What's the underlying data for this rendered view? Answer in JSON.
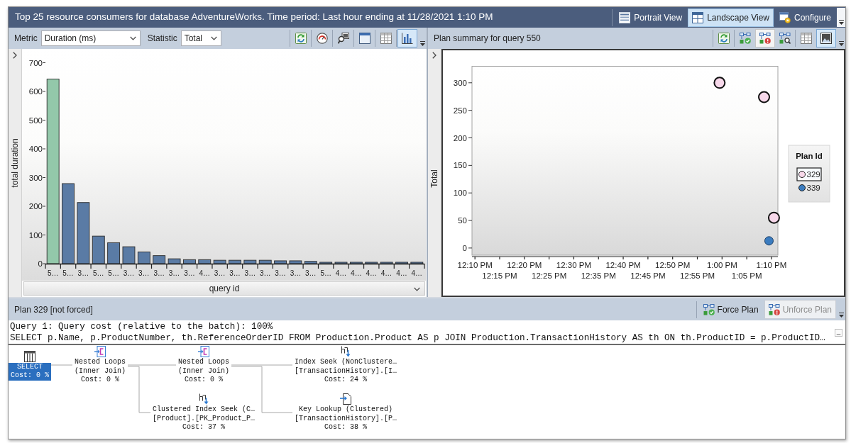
{
  "window": {
    "title": "Top 25 resource consumers for database AdventureWorks. Time period: Last hour ending at 11/28/2021 1:10 PM",
    "view_buttons": [
      {
        "kind": "portrait",
        "label": "Portrait View",
        "selected": false
      },
      {
        "kind": "landscape",
        "label": "Landscape View",
        "selected": true
      },
      {
        "kind": "configure",
        "label": "Configure",
        "selected": false
      }
    ]
  },
  "top_consumers": {
    "fields": [
      {
        "label": "Metric",
        "value": "Duration (ms)"
      },
      {
        "label": "Statistic",
        "value": "Total"
      }
    ],
    "toolbar": [
      {
        "kind": "refresh",
        "selected": false
      },
      {
        "kind": "track",
        "selected": false
      },
      {
        "kind": "view_query",
        "selected": false
      },
      {
        "kind": "window",
        "selected": false
      },
      {
        "kind": "grid",
        "selected": false
      },
      {
        "kind": "bar_chart",
        "selected": true
      }
    ],
    "chart_data": {
      "type": "bar",
      "xlabel": "query id",
      "ylabel": "total duration",
      "categories": [
        "5…",
        "5…",
        "3…",
        "5…",
        "5…",
        "3…",
        "3…",
        "3…",
        "3…",
        "3…",
        "4…",
        "3…",
        "3…",
        "3…",
        "3…",
        "3…",
        "3…",
        "3…",
        "5…",
        "4…",
        "4…",
        "4…",
        "4…",
        "4…",
        "4…"
      ],
      "series": [
        {
          "color": "#93c8aa",
          "values": [
            643,
            null,
            null,
            null,
            null,
            null,
            null,
            null,
            null,
            null,
            null,
            null,
            null,
            null,
            null,
            null,
            null,
            null,
            null,
            null,
            null,
            null,
            null,
            null,
            null
          ]
        },
        {
          "color": "#5a7ba5",
          "values": [
            null,
            279,
            213,
            96,
            73,
            59,
            41,
            28,
            17,
            14,
            14,
            12,
            12,
            12,
            12,
            10,
            10,
            8,
            5,
            5,
            5,
            5,
            5,
            5,
            5
          ]
        }
      ],
      "stacked": true,
      "ylim": [
        0,
        700
      ],
      "yticks": [
        0,
        100,
        200,
        300,
        400,
        500,
        600,
        700
      ]
    }
  },
  "plan_summary": {
    "title": "Plan summary for query 550",
    "toolbar": [
      {
        "kind": "refresh",
        "selected": false,
        "disabled": false
      },
      {
        "kind": "force",
        "selected": false,
        "disabled": false
      },
      {
        "kind": "unforce",
        "selected": false,
        "disabled": true
      },
      {
        "kind": "compare",
        "selected": false,
        "disabled": false
      },
      {
        "kind": "grid",
        "selected": false,
        "disabled": false
      },
      {
        "kind": "chart_image",
        "selected": true,
        "disabled": false
      }
    ],
    "legend": {
      "title": "Plan Id",
      "items": [
        {
          "selected": true
        },
        {
          "selected": false
        }
      ]
    },
    "chart_data": {
      "type": "scatter",
      "ylabel": "Total",
      "legend": "right",
      "categories": [
        "12:10 PM",
        null,
        null,
        null,
        null,
        null,
        null,
        null,
        null,
        null,
        "12:15 PM",
        null,
        null,
        null,
        null,
        null,
        null,
        null,
        null,
        null,
        "12:20 PM",
        null,
        null,
        null,
        null,
        null,
        null,
        null,
        null,
        null,
        "12:25 PM",
        null,
        null,
        null,
        null,
        null,
        null,
        null,
        null,
        null,
        "12:30 PM",
        null,
        null,
        null,
        null,
        null,
        null,
        null,
        null,
        null,
        "12:35 PM",
        null,
        null,
        null,
        null,
        null,
        null,
        null,
        null,
        null,
        "12:40 PM",
        null,
        null,
        null,
        null,
        null,
        null,
        null,
        null,
        null,
        "12:45 PM",
        null,
        null,
        null,
        null,
        null,
        null,
        null,
        null,
        null,
        "12:50 PM",
        null,
        null,
        null,
        null,
        null,
        null,
        null,
        null,
        null,
        "12:55 PM",
        null,
        null,
        null,
        null,
        null,
        null,
        null,
        null,
        null,
        "1:00 PM",
        null,
        null,
        null,
        null,
        null,
        null,
        null,
        null,
        null,
        "1:05 PM",
        null,
        null,
        null,
        null,
        null,
        null,
        null,
        null,
        null,
        "1:10 PM",
        null
      ],
      "series": [
        {
          "name": "329",
          "color": "#f7d8ea",
          "values": [
            null,
            null,
            null,
            null,
            null,
            null,
            null,
            null,
            null,
            null,
            null,
            null,
            null,
            null,
            null,
            null,
            null,
            null,
            null,
            null,
            null,
            null,
            null,
            null,
            null,
            null,
            null,
            null,
            null,
            null,
            null,
            null,
            null,
            null,
            null,
            null,
            null,
            null,
            null,
            null,
            null,
            null,
            null,
            null,
            null,
            null,
            null,
            null,
            null,
            null,
            null,
            null,
            null,
            null,
            null,
            null,
            null,
            null,
            null,
            null,
            null,
            null,
            null,
            null,
            null,
            null,
            null,
            null,
            null,
            null,
            null,
            null,
            null,
            null,
            null,
            null,
            null,
            null,
            null,
            null,
            null,
            null,
            null,
            null,
            null,
            null,
            null,
            null,
            null,
            null,
            null,
            null,
            null,
            null,
            null,
            null,
            null,
            null,
            null,
            300,
            null,
            null,
            null,
            null,
            null,
            null,
            null,
            null,
            null,
            null,
            null,
            null,
            null,
            null,
            null,
            null,
            null,
            274,
            null,
            null,
            null,
            55
          ]
        },
        {
          "name": "339",
          "color": "#3b7cbf",
          "values": [
            null,
            null,
            null,
            null,
            null,
            null,
            null,
            null,
            null,
            null,
            null,
            null,
            null,
            null,
            null,
            null,
            null,
            null,
            null,
            null,
            null,
            null,
            null,
            null,
            null,
            null,
            null,
            null,
            null,
            null,
            null,
            null,
            null,
            null,
            null,
            null,
            null,
            null,
            null,
            null,
            null,
            null,
            null,
            null,
            null,
            null,
            null,
            null,
            null,
            null,
            null,
            null,
            null,
            null,
            null,
            null,
            null,
            null,
            null,
            null,
            null,
            null,
            null,
            null,
            null,
            null,
            null,
            null,
            null,
            null,
            null,
            null,
            null,
            null,
            null,
            null,
            null,
            null,
            null,
            null,
            null,
            null,
            null,
            null,
            null,
            null,
            null,
            null,
            null,
            null,
            null,
            null,
            null,
            null,
            null,
            null,
            null,
            null,
            null,
            null,
            null,
            null,
            null,
            null,
            null,
            null,
            null,
            null,
            null,
            null,
            null,
            null,
            null,
            null,
            null,
            null,
            null,
            null,
            null,
            13,
            null,
            null
          ]
        }
      ],
      "ylim": [
        -13,
        330
      ],
      "yticks": [
        0,
        50,
        100,
        150,
        200,
        250,
        300
      ]
    }
  },
  "plan": {
    "title": "Plan 329 [not forced]",
    "buttons": [
      {
        "kind": "force",
        "label": "Force Plan",
        "disabled": false
      },
      {
        "kind": "unforce",
        "label": "Unforce Plan",
        "disabled": true
      }
    ],
    "query_header": "Query 1: Query cost (relative to the batch): 100%",
    "statement": "SELECT p.Name, p.ProductNumber, th.ReferenceOrderID FROM Production.Product AS p JOIN Production.TransactionHistory AS th ON th.ProductID = p.ProductID…",
    "tree": {
      "kind": "select",
      "lines": [
        "SELECT",
        "Cost: 0 %"
      ],
      "selected": true,
      "children": [
        {
          "kind": "nested_loops",
          "lines": [
            "Nested Loops",
            "(Inner Join)",
            "Cost: 0 %"
          ],
          "selected": false,
          "children": [
            {
              "kind": "nested_loops",
              "lines": [
                "Nested Loops",
                "(Inner Join)",
                "Cost: 0 %"
              ],
              "selected": false,
              "children": [
                {
                  "kind": "index_seek",
                  "lines": [
                    "Index Seek (NonClustere…",
                    "[TransactionHistory].[I…",
                    "Cost: 24 %"
                  ],
                  "selected": false
                },
                {
                  "kind": "key_lookup",
                  "lines": [
                    "Key Lookup (Clustered)",
                    "[TransactionHistory].[P…",
                    "Cost: 38 %"
                  ],
                  "selected": false
                }
              ]
            },
            {
              "kind": "clustered_index_seek",
              "lines": [
                "Clustered Index Seek (C…",
                "[Product].[PK_Product_P…",
                "Cost: 37 %"
              ],
              "selected": false
            }
          ]
        }
      ]
    }
  }
}
